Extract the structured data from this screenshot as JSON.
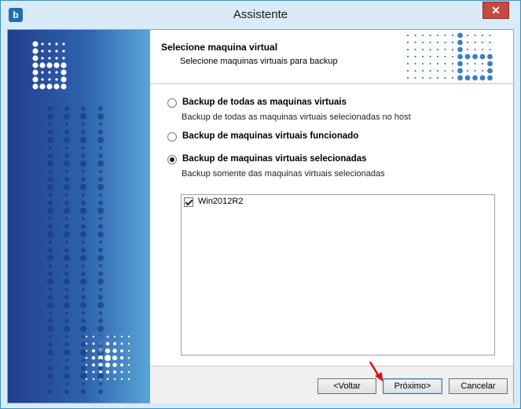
{
  "window": {
    "title": "Assistente",
    "close_label": "✕"
  },
  "header": {
    "title": "Selecione maquina virtual",
    "subtitle": "Selecione maquinas virtuais para backup"
  },
  "options": [
    {
      "label": "Backup de todas as maquinas virtuais",
      "description": "Backup de todas as maquinas virtuais selecionadas no host",
      "selected": false
    },
    {
      "label": "Backup de maquinas virtuais funcionado",
      "description": "",
      "selected": false
    },
    {
      "label": "Backup de maquinas virtuais selecionadas",
      "description": "Backup somente das maquinas virtuais selecionadas",
      "selected": true
    }
  ],
  "vm_list": [
    {
      "name": "Win2012R2",
      "checked": true
    }
  ],
  "buttons": {
    "back": "<Voltar",
    "next": "Próximo>",
    "cancel": "Cancelar"
  },
  "colors": {
    "panel_dark": "#1f3d8a",
    "panel_mid": "#3a7fc4",
    "dot_light": "#ffffff",
    "accent_arrow": "#e01010"
  }
}
